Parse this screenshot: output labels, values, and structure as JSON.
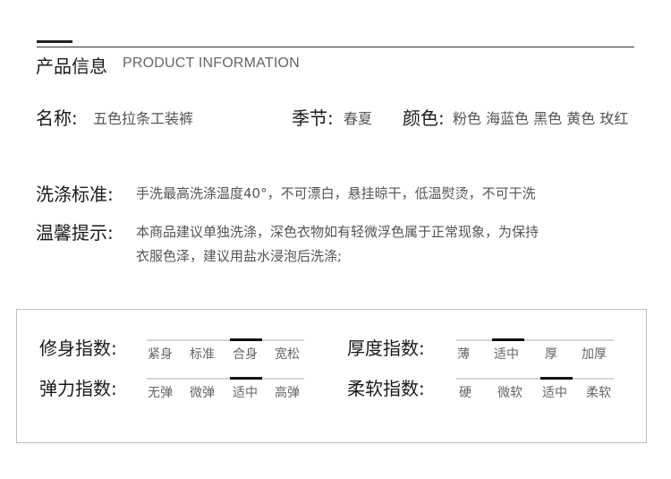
{
  "header": {
    "title_zh": "产品信息",
    "title_en": "PRODUCT INFORMATION"
  },
  "specs": {
    "name": {
      "label": "名称:",
      "value": "五色拉条工装裤"
    },
    "season": {
      "label": "季节:",
      "value": "春夏"
    },
    "color": {
      "label": "颜色:",
      "value": "粉色 海蓝色 黑色 黄色  玫红"
    },
    "wash": {
      "label": "洗涤标准:",
      "value": "手洗最高洗涤温度40°，不可漂白，悬挂晾干，低温熨烫，不可干洗"
    },
    "tips": {
      "label": "温馨提示:",
      "line1": "本商品建议单独洗涤，深色衣物如有轻微浮色属于正常现象，为保持",
      "line2": "衣服色泽，建议用盐水浸泡后洗涤;"
    }
  },
  "indices": {
    "fit": {
      "label": "修身指数:",
      "options": [
        "紧身",
        "标准",
        "合身",
        "宽松"
      ],
      "selected": "合身"
    },
    "elastic": {
      "label": "弹力指数:",
      "options": [
        "无弹",
        "微弹",
        "适中",
        "高弹"
      ],
      "selected": "适中"
    },
    "thickness": {
      "label": "厚度指数:",
      "options": [
        "薄",
        "适中",
        "厚",
        "加厚"
      ],
      "selected": "适中"
    },
    "softness": {
      "label": "柔软指数:",
      "options": [
        "硬",
        "微软",
        "适中",
        "柔软"
      ],
      "selected": "适中"
    }
  }
}
